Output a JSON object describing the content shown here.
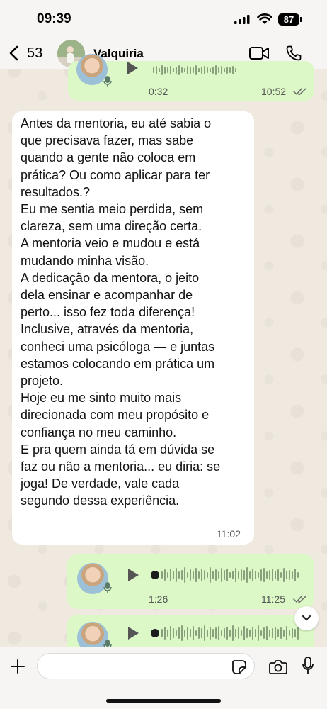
{
  "status_bar": {
    "time": "09:39",
    "battery": "87"
  },
  "header": {
    "back_count": "53",
    "contact_name": "Valquiria"
  },
  "messages": [
    {
      "type": "voice",
      "direction": "outgoing",
      "duration": "0:32",
      "time": "10:52",
      "status": "read"
    },
    {
      "type": "text",
      "direction": "incoming",
      "text": "Antes da mentoria, eu até sabia o\nque precisava fazer, mas sabe\nquando a gente não coloca em\nprática? Ou como aplicar para ter\nresultados.?\nEu me sentia meio perdida, sem\nclareza, sem uma direção certa.\nA mentoria veio e mudou e está\nmudando minha visão.\nA dedicação da mentora, o jeito\ndela ensinar e acompanhar de\nperto... isso fez toda diferença!\nInclusive, através da mentoria,\nconheci uma psicóloga — e juntas\nestamos colocando em prática um\nprojeto.\nHoje eu me sinto muito mais\ndirecionada com meu propósito e\nconfiança no meu caminho.\nE pra quem ainda tá em dúvida se\nfaz ou não a mentoria... eu diria: se\njoga! De verdade, vale cada\nsegundo dessa experiência.",
      "time": "11:02"
    },
    {
      "type": "voice",
      "direction": "outgoing",
      "duration": "1:26",
      "time": "11:25",
      "status": "read"
    },
    {
      "type": "voice",
      "direction": "outgoing",
      "duration": "",
      "time": "",
      "status": ""
    }
  ],
  "input": {
    "placeholder": ""
  },
  "colors": {
    "outgoing_bubble": "#dcf8c6",
    "incoming_bubble": "#ffffff",
    "read_tick": "#34b7f1"
  },
  "icons": {
    "back": "chevron-left-icon",
    "video": "video-camera-icon",
    "phone": "phone-icon",
    "attach": "plus-icon",
    "sticker": "sticker-icon",
    "camera": "camera-icon",
    "mic": "microphone-icon",
    "scroll": "chevron-down-icon"
  }
}
